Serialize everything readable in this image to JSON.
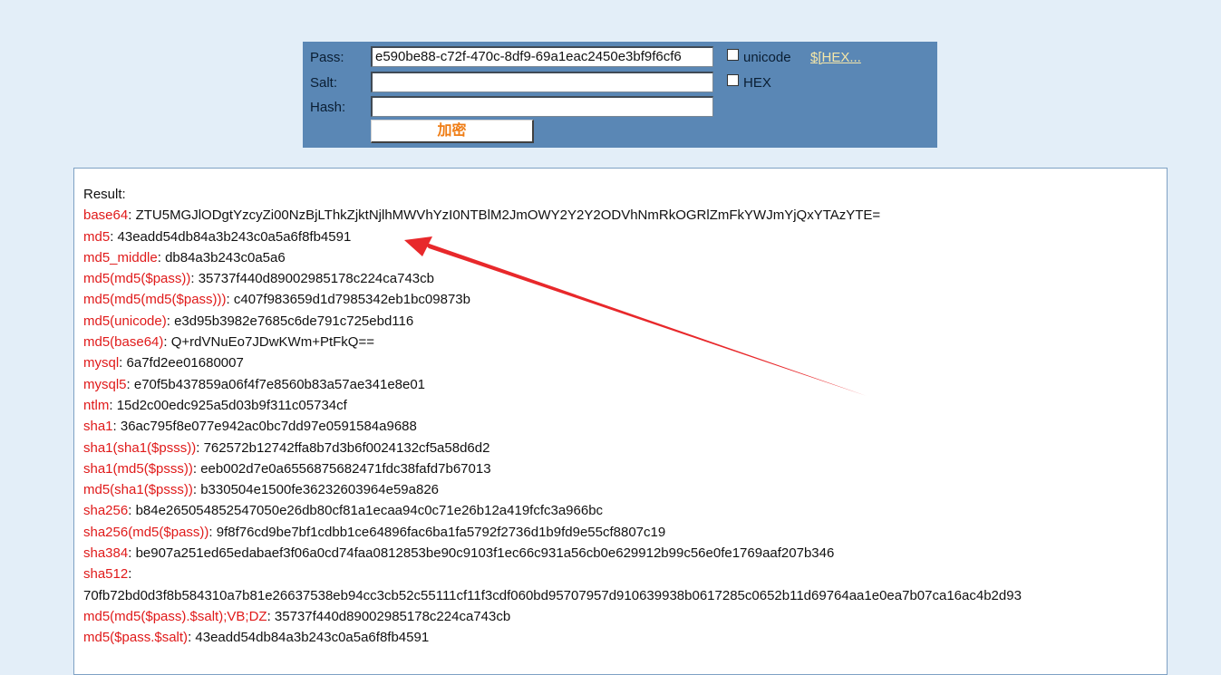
{
  "form": {
    "pass_label": "Pass:",
    "salt_label": "Salt:",
    "hash_label": "Hash:",
    "pass_value": "e590be88-c72f-470c-8df9-69a1eac2450e3bf9f6cf6",
    "salt_value": "",
    "hash_value": "",
    "unicode_label": "unicode",
    "hex_label": "HEX",
    "hex_link": "$[HEX...",
    "submit_label": "加密"
  },
  "result": {
    "label": "Result:",
    "rows": [
      {
        "key": "base64",
        "value": "ZTU5MGJlODgtYzcyZi00NzBjLThkZjktNjlhMWVhYzI0NTBlM2JmOWY2Y2Y2ODVhNmRkOGRlZmFkYWJmYjQxYTAzYTE="
      },
      {
        "key": "md5",
        "value": "43eadd54db84a3b243c0a5a6f8fb4591"
      },
      {
        "key": "md5_middle",
        "value": "db84a3b243c0a5a6"
      },
      {
        "key": "md5(md5($pass))",
        "value": "35737f440d89002985178c224ca743cb"
      },
      {
        "key": "md5(md5(md5($pass)))",
        "value": "c407f983659d1d7985342eb1bc09873b"
      },
      {
        "key": "md5(unicode)",
        "value": "e3d95b3982e7685c6de791c725ebd116"
      },
      {
        "key": "md5(base64)",
        "value": "Q+rdVNuEo7JDwKWm+PtFkQ=="
      },
      {
        "key": "mysql",
        "value": "6a7fd2ee01680007"
      },
      {
        "key": "mysql5",
        "value": "e70f5b437859a06f4f7e8560b83a57ae341e8e01"
      },
      {
        "key": "ntlm",
        "value": "15d2c00edc925a5d03b9f311c05734cf"
      },
      {
        "key": "sha1",
        "value": "36ac795f8e077e942ac0bc7dd97e0591584a9688"
      },
      {
        "key": "sha1(sha1($psss))",
        "value": "762572b12742ffa8b7d3b6f0024132cf5a58d6d2"
      },
      {
        "key": "sha1(md5($psss))",
        "value": "eeb002d7e0a6556875682471fdc38fafd7b67013"
      },
      {
        "key": "md5(sha1($psss))",
        "value": "b330504e1500fe36232603964e59a826"
      },
      {
        "key": "sha256",
        "value": "b84e265054852547050e26db80cf81a1ecaa94c0c71e26b12a419fcfc3a966bc"
      },
      {
        "key": "sha256(md5($pass))",
        "value": "9f8f76cd9be7bf1cdbb1ce64896fac6ba1fa5792f2736d1b9fd9e55cf8807c19"
      },
      {
        "key": "sha384",
        "value": "be907a251ed65edabaef3f06a0cd74faa0812853be90c9103f1ec66c931a56cb0e629912b99c56e0fe1769aaf207b346"
      },
      {
        "key": "sha512",
        "value": ""
      },
      {
        "key": "",
        "value": "70fb72bd0d3f8b584310a7b81e26637538eb94cc3cb52c55111cf11f3cdf060bd95707957d910639938b0617285c0652b11d69764aa1e0ea7b07ca16ac4b2d93"
      },
      {
        "key": "md5(md5($pass).$salt);VB;DZ",
        "value": "35737f440d89002985178c224ca743cb"
      },
      {
        "key": "md5($pass.$salt)",
        "value": "43eadd54db84a3b243c0a5a6f8fb4591"
      }
    ]
  },
  "colors": {
    "page_bg": "#e3eef8",
    "form_bg": "#5a87b5",
    "result_key": "#e01a1a",
    "submit_text": "#ef7d15",
    "link": "#f6e7a8",
    "annotation_arrow": "#e8282b"
  }
}
